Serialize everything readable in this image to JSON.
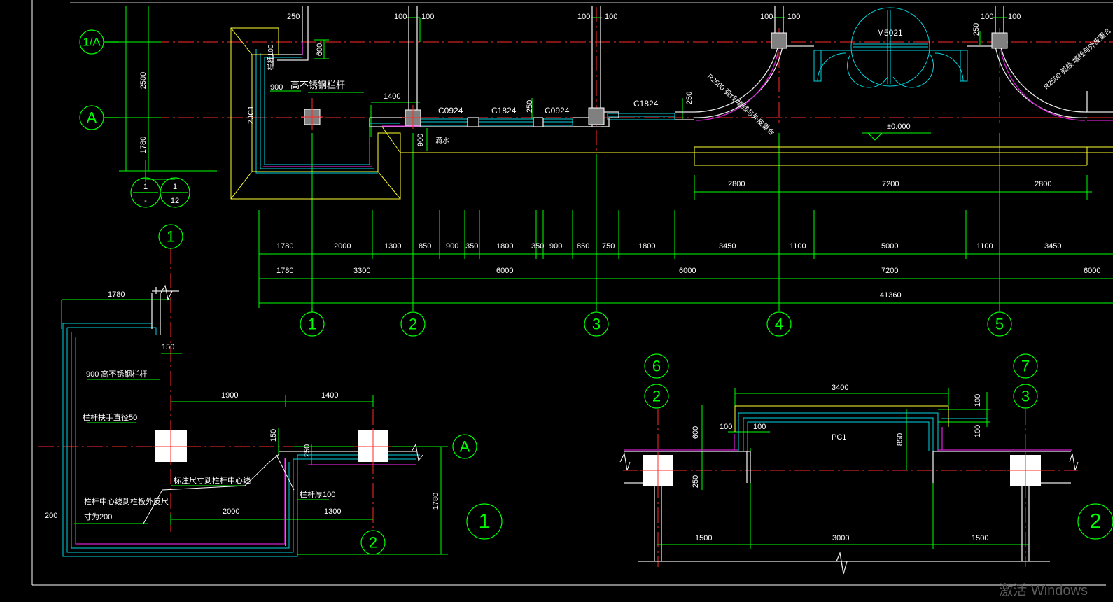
{
  "watermark": "激活 Windows",
  "plan": {
    "axis_bubbles": [
      "1/A",
      "A",
      "1",
      "1",
      "1",
      "2",
      "3",
      "4",
      "5",
      "6",
      "7",
      "2",
      "3",
      "A",
      "1",
      "2",
      "2"
    ],
    "detail_ref": {
      "top_left": "1",
      "top_right": "1",
      "bottom_left": "-",
      "bottom_right": "12"
    },
    "top_dims": [
      "250",
      "100",
      "100",
      "100",
      "100",
      "100",
      "100",
      "100",
      "100"
    ],
    "vertical_dims": [
      "2500",
      "1780",
      "600",
      "250",
      "900",
      "250"
    ],
    "windows": [
      "C0924",
      "C1824",
      "C0924",
      "C1824"
    ],
    "door": "M5021",
    "small_dims": [
      "1400",
      "250"
    ],
    "labels": {
      "railing": "高不锈钢栏杆",
      "railing_height": "900",
      "railing_post": "栏杆100",
      "column_tag": "ZJC1",
      "slope": "滴水",
      "arc_left": "R2500 弧线 墙线与外皮重合",
      "arc_right": "R2500 弧线 墙线与外皮重合",
      "elevation": "±0.000"
    },
    "arc_dims": [
      "2800",
      "7200",
      "2800"
    ],
    "dim_row1": [
      "1780",
      "2000",
      "1300",
      "850",
      "900",
      "350",
      "1800",
      "350",
      "900",
      "850",
      "750",
      "1800",
      "3450",
      "1100",
      "5000",
      "1100",
      "3450"
    ],
    "dim_row2": [
      "1780",
      "3300",
      "6000",
      "6000",
      "7200",
      "6000"
    ],
    "dim_total": "41360"
  },
  "detail1": {
    "dims": [
      "1780",
      "150",
      "1900",
      "1400",
      "150",
      "250",
      "2000",
      "1300",
      "1780",
      "200"
    ],
    "notes": [
      "900 高不锈钢栏杆",
      "栏杆扶手直径50",
      "标注尺寸到栏杆中心线",
      "栏杆厚100",
      "栏杆中心线到栏板外皮尺",
      "寸为200"
    ]
  },
  "detail2": {
    "dims": [
      "3400",
      "100",
      "100",
      "600",
      "100",
      "100",
      "850",
      "250",
      "1500",
      "3000",
      "1500"
    ],
    "label": "PC1"
  }
}
